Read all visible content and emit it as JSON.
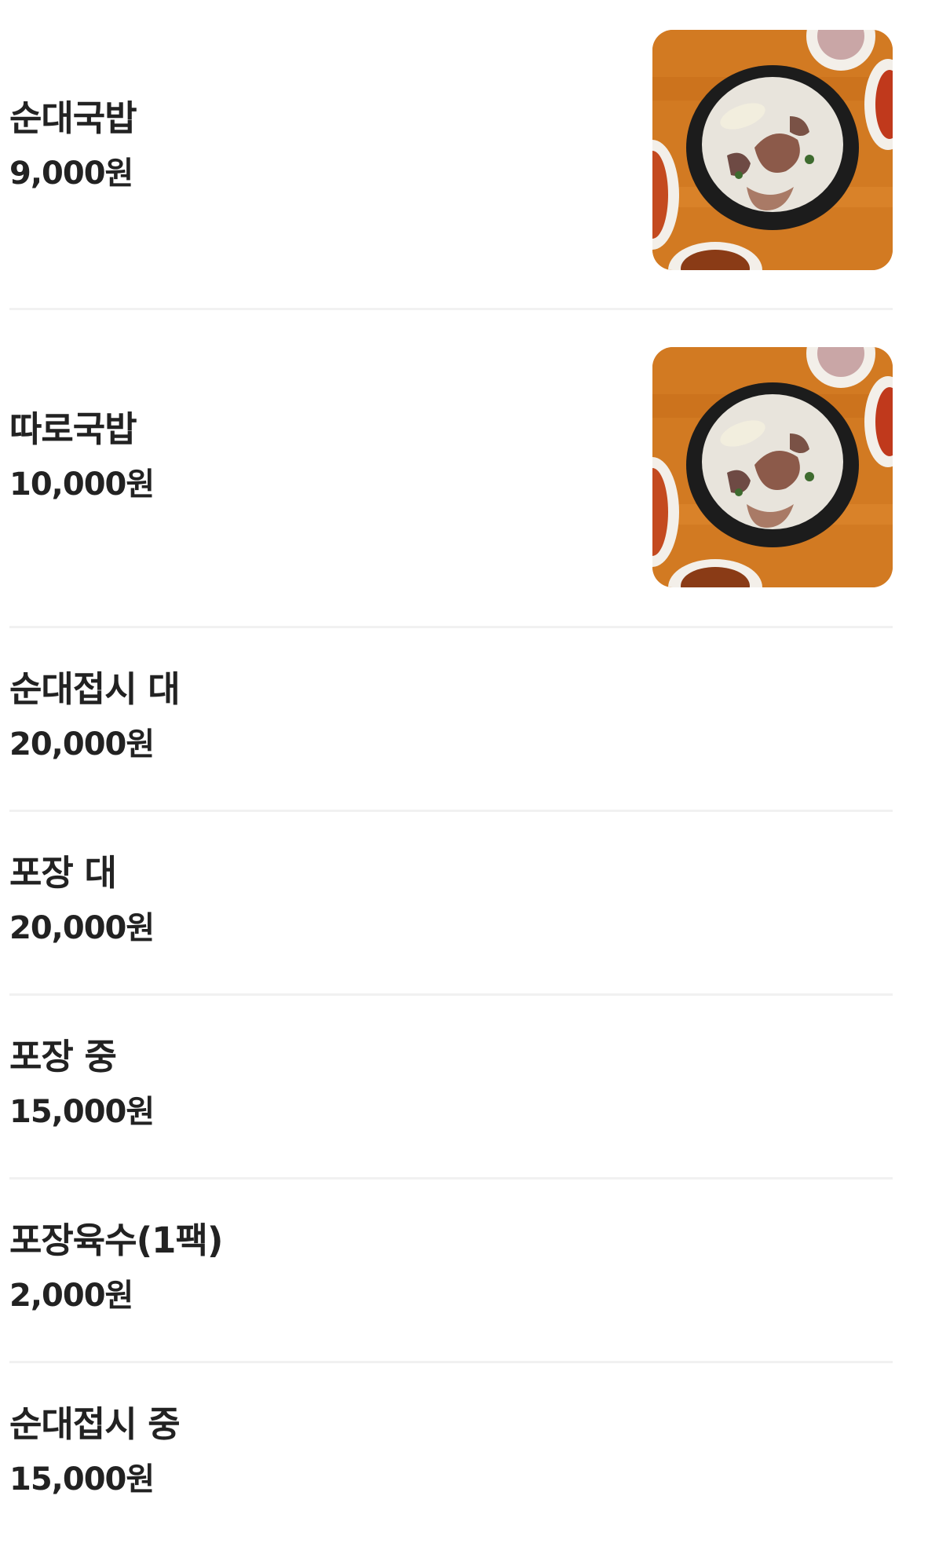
{
  "menu": {
    "items": [
      {
        "name": "순대국밥",
        "price": "9,000원",
        "photo": "gukbap-photo"
      },
      {
        "name": "따로국밥",
        "price": "10,000원",
        "photo": "gukbap-photo"
      },
      {
        "name": "순대접시 대",
        "price": "20,000원"
      },
      {
        "name": "포장 대",
        "price": "20,000원"
      },
      {
        "name": "포장 중",
        "price": "15,000원"
      },
      {
        "name": "포장육수(1팩)",
        "price": "2,000원"
      },
      {
        "name": "순대접시 중",
        "price": "15,000원"
      }
    ]
  },
  "colors": {
    "text": "#222222",
    "divider": "#f1f1f1",
    "table_wood": "#d4781f",
    "broth": "#e8e4dc",
    "pot": "#1c1c1c"
  }
}
